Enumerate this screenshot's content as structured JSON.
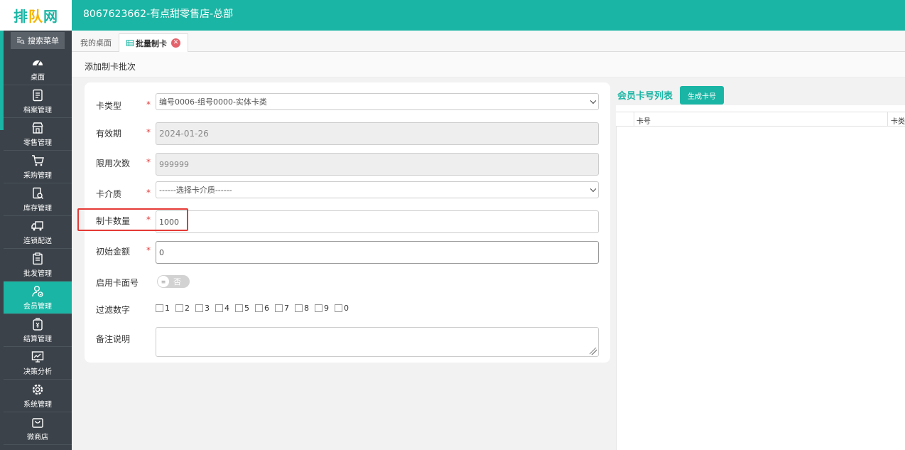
{
  "header": {
    "logo": {
      "part1": "排",
      "part2": "队",
      "part3": "网"
    },
    "title": "8067623662-有点甜零售店-总部"
  },
  "sidebar": {
    "search_label": "搜索菜单",
    "items": [
      {
        "label": "桌面",
        "icon": "dashboard-icon"
      },
      {
        "label": "档案管理",
        "icon": "archive-icon"
      },
      {
        "label": "零售管理",
        "icon": "store-icon"
      },
      {
        "label": "采购管理",
        "icon": "cart-icon"
      },
      {
        "label": "库存管理",
        "icon": "inventory-icon"
      },
      {
        "label": "连锁配送",
        "icon": "truck-icon"
      },
      {
        "label": "批发管理",
        "icon": "clipboard-icon"
      },
      {
        "label": "会员管理",
        "icon": "member-icon",
        "active": true
      },
      {
        "label": "结算管理",
        "icon": "settlement-icon"
      },
      {
        "label": "决策分析",
        "icon": "chart-icon"
      },
      {
        "label": "系统管理",
        "icon": "gear-icon"
      },
      {
        "label": "微商店",
        "icon": "bag-icon"
      }
    ]
  },
  "tabs": [
    {
      "label": "我的桌面"
    },
    {
      "label": "批量制卡",
      "active": true
    }
  ],
  "page": {
    "subtitle": "添加制卡批次"
  },
  "form": {
    "card_type": {
      "label": "卡类型",
      "value": "编号0006-组号0000-实体卡类"
    },
    "valid_until": {
      "label": "有效期",
      "value": "2024-01-26"
    },
    "use_limit": {
      "label": "限用次数",
      "value": "999999"
    },
    "card_medium": {
      "label": "卡介质",
      "value": "------选择卡介质------"
    },
    "card_count": {
      "label": "制卡数量",
      "value": "1000"
    },
    "initial_amount": {
      "label": "初始金额",
      "value": "0"
    },
    "enable_face_no": {
      "label": "启用卡面号",
      "toggle_text": "否"
    },
    "filter_digits": {
      "label": "过滤数字",
      "digits": [
        "1",
        "2",
        "3",
        "4",
        "5",
        "6",
        "7",
        "8",
        "9",
        "0"
      ]
    },
    "remarks": {
      "label": "备注说明",
      "value": ""
    },
    "required_mark": "*"
  },
  "right_panel": {
    "title": "会员卡号列表",
    "generate_button": "生成卡号",
    "columns": [
      "卡号",
      "卡类"
    ]
  }
}
